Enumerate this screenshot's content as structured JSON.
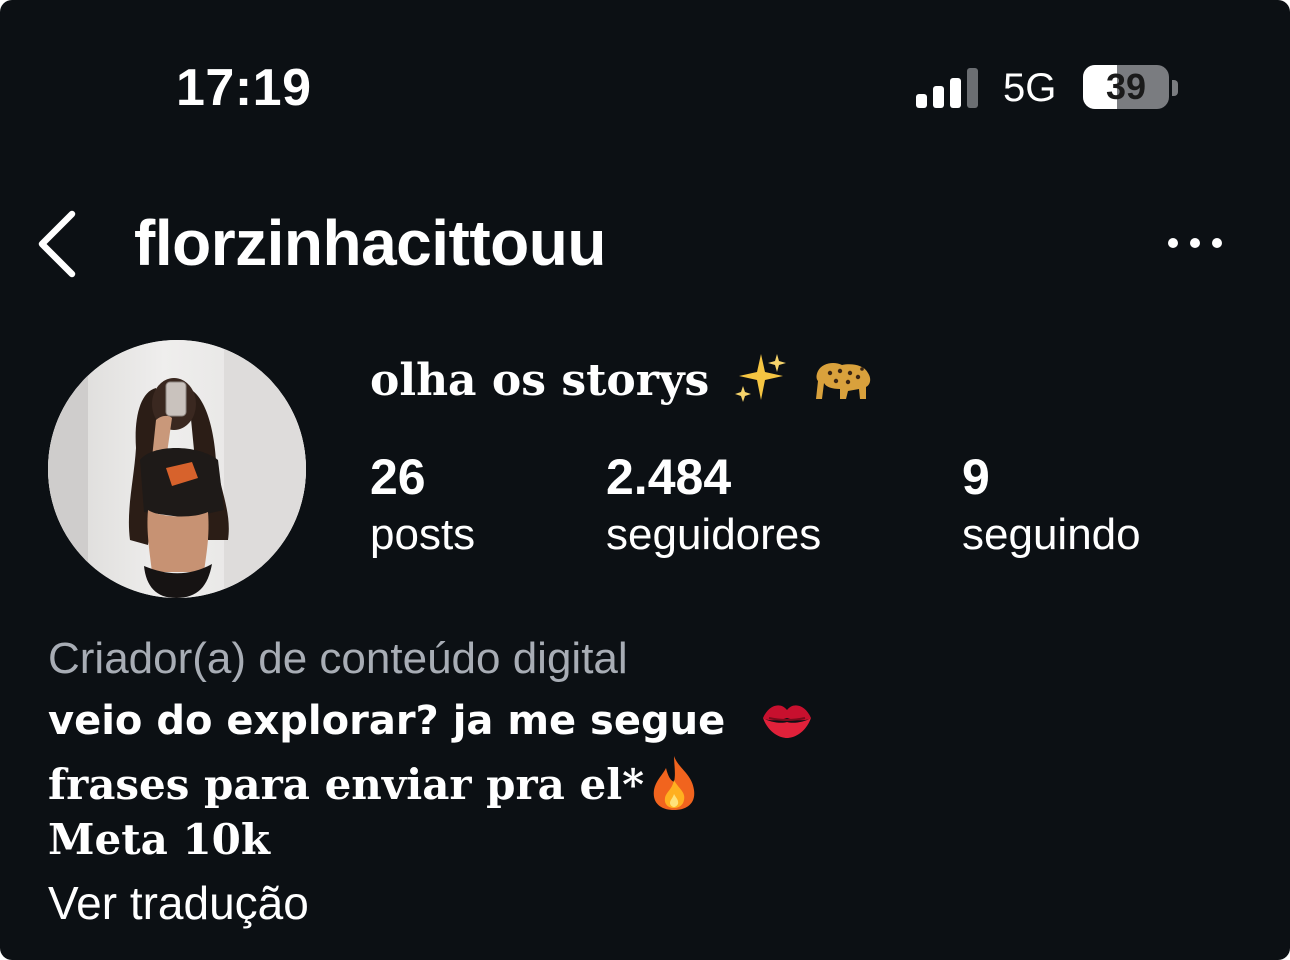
{
  "status_bar": {
    "time": "17:19",
    "network": "5G",
    "battery_percent": "39",
    "battery_level": 0.39,
    "signal_bars_active": 3,
    "signal_bars_total": 4
  },
  "header": {
    "username": "florzinhacittouu",
    "back_icon": "chevron-left-icon",
    "more_icon": "ellipsis-horizontal-icon"
  },
  "profile": {
    "display_name": "olha os storys",
    "display_name_emojis": [
      "sparkles-icon",
      "leopard-icon"
    ],
    "stats": {
      "posts": {
        "value": "26",
        "label": "posts"
      },
      "followers": {
        "value": "2.484",
        "label": "seguidores"
      },
      "following": {
        "value": "9",
        "label": "seguindo"
      }
    }
  },
  "bio": {
    "category": "Criador(a) de conteúdo digital",
    "line1": "veio do explorar? ja me segue",
    "line1_emoji": "kiss-mark-icon",
    "line2": "frases para enviar pra el*",
    "line2_emoji": "fire-icon",
    "line3": "Meta 10k",
    "translate_link": "Ver tradução"
  },
  "colors": {
    "background": "#0c1014",
    "text_primary": "#ffffff",
    "text_secondary": "#a8adb5"
  }
}
